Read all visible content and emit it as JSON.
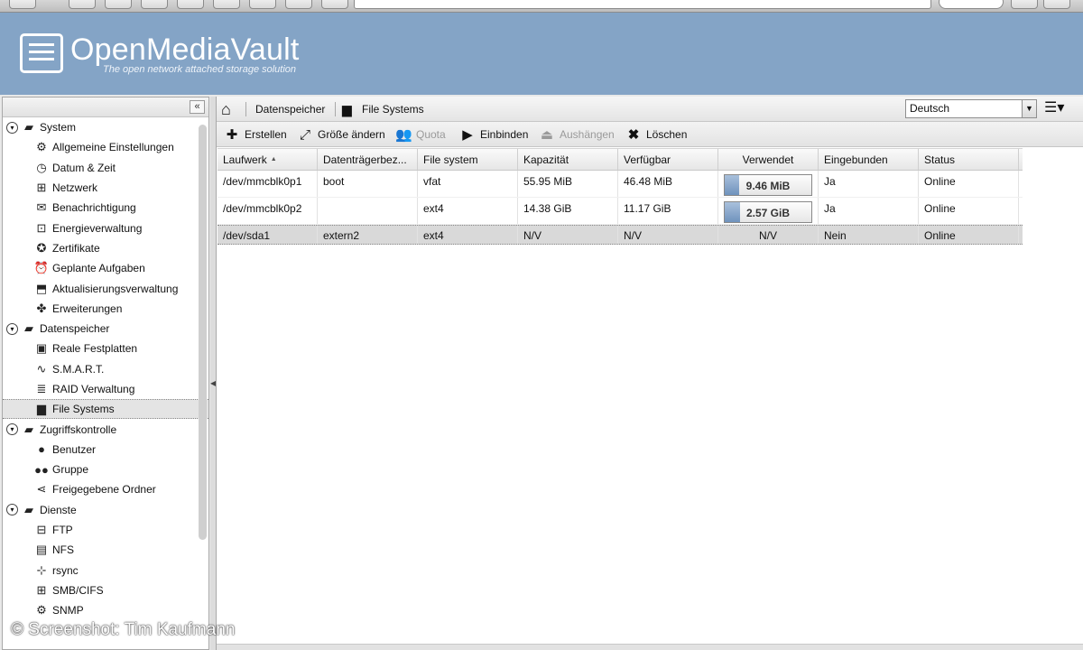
{
  "header": {
    "title": "OpenMediaVault",
    "subtitle": "The open network attached storage solution"
  },
  "sidebar": {
    "collapse_label": "«",
    "groups": [
      {
        "label": "System",
        "items": [
          {
            "label": "Allgemeine Einstellungen",
            "icon": "gears-icon"
          },
          {
            "label": "Datum & Zeit",
            "icon": "clock-icon"
          },
          {
            "label": "Netzwerk",
            "icon": "network-icon"
          },
          {
            "label": "Benachrichtigung",
            "icon": "envelope-icon"
          },
          {
            "label": "Energieverwaltung",
            "icon": "power-icon"
          },
          {
            "label": "Zertifikate",
            "icon": "certificate-icon"
          },
          {
            "label": "Geplante Aufgaben",
            "icon": "alarm-clock-icon"
          },
          {
            "label": "Aktualisierungsverwaltung",
            "icon": "update-icon"
          },
          {
            "label": "Erweiterungen",
            "icon": "puzzle-icon"
          }
        ]
      },
      {
        "label": "Datenspeicher",
        "items": [
          {
            "label": "Reale Festplatten",
            "icon": "disk-icon"
          },
          {
            "label": "S.M.A.R.T.",
            "icon": "smart-icon"
          },
          {
            "label": "RAID Verwaltung",
            "icon": "database-icon"
          },
          {
            "label": "File Systems",
            "icon": "folder-icon",
            "selected": true
          }
        ]
      },
      {
        "label": "Zugriffskontrolle",
        "items": [
          {
            "label": "Benutzer",
            "icon": "user-icon"
          },
          {
            "label": "Gruppe",
            "icon": "group-icon"
          },
          {
            "label": "Freigegebene Ordner",
            "icon": "share-icon"
          }
        ]
      },
      {
        "label": "Dienste",
        "items": [
          {
            "label": "FTP",
            "icon": "ftp-icon"
          },
          {
            "label": "NFS",
            "icon": "nfs-icon"
          },
          {
            "label": "rsync",
            "icon": "rsync-icon"
          },
          {
            "label": "SMB/CIFS",
            "icon": "windows-icon"
          },
          {
            "label": "SNMP",
            "icon": "snmp-icon"
          }
        ]
      }
    ]
  },
  "breadcrumb": {
    "level1": "Datenspeicher",
    "level2": "File Systems"
  },
  "language": {
    "selected": "Deutsch"
  },
  "toolbar": {
    "create": "Erstellen",
    "resize": "Größe ändern",
    "quota": "Quota",
    "mount": "Einbinden",
    "unmount": "Aushängen",
    "delete": "Löschen"
  },
  "grid": {
    "columns": [
      "Laufwerk",
      "Datenträgerbez...",
      "File system",
      "Kapazität",
      "Verfügbar",
      "Verwendet",
      "Eingebunden",
      "Status"
    ],
    "sort_indicator": "▲",
    "rows": [
      {
        "device": "/dev/mmcblk0p1",
        "label": "boot",
        "fs": "vfat",
        "capacity": "55.95 MiB",
        "available": "46.48 MiB",
        "used": "9.46 MiB",
        "used_fraction": 0.17,
        "mounted": "Ja",
        "status": "Online",
        "selected": false
      },
      {
        "device": "/dev/mmcblk0p2",
        "label": "",
        "fs": "ext4",
        "capacity": "14.38 GiB",
        "available": "11.17 GiB",
        "used": "2.57 GiB",
        "used_fraction": 0.18,
        "mounted": "Ja",
        "status": "Online",
        "selected": false
      },
      {
        "device": "/dev/sda1",
        "label": "extern2",
        "fs": "ext4",
        "capacity": "N/V",
        "available": "N/V",
        "used": "N/V",
        "used_fraction": null,
        "mounted": "Nein",
        "status": "Online",
        "selected": true
      }
    ]
  },
  "watermark": "© Screenshot: Tim Kaufmann"
}
